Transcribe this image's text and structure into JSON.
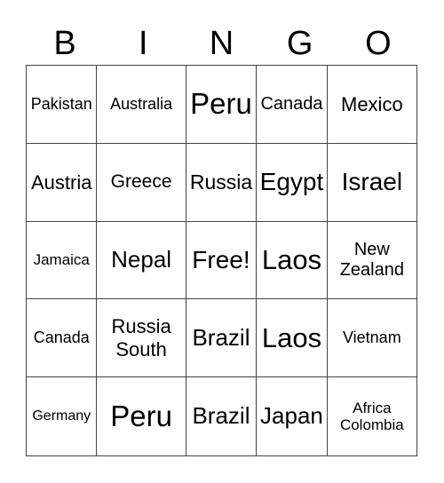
{
  "header": [
    "B",
    "I",
    "N",
    "G",
    "O"
  ],
  "cells": [
    {
      "text": "Pakistan"
    },
    {
      "text": "Australia"
    },
    {
      "text": "Peru"
    },
    {
      "text": "Canada"
    },
    {
      "text": "Mexico"
    },
    {
      "text": "Austria"
    },
    {
      "text": "Greece"
    },
    {
      "text": "Russia"
    },
    {
      "text": "Egypt"
    },
    {
      "text": "Israel"
    },
    {
      "text": "Jamaica"
    },
    {
      "text": "Nepal"
    },
    {
      "text": "Free!"
    },
    {
      "text": "Laos"
    },
    {
      "text": "New Zealand"
    },
    {
      "text": "Canada"
    },
    {
      "text": "Russia South"
    },
    {
      "text": "Brazil"
    },
    {
      "text": "Laos"
    },
    {
      "text": "Vietnam"
    },
    {
      "text": "Germany"
    },
    {
      "text": "Peru"
    },
    {
      "text": "Brazil"
    },
    {
      "text": "Japan"
    },
    {
      "text": "Africa Colombia"
    }
  ]
}
